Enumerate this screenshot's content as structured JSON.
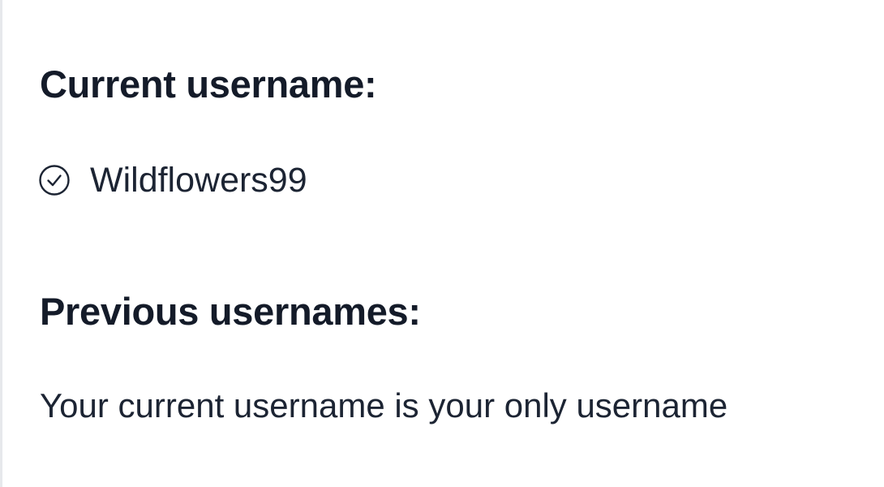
{
  "current": {
    "heading": "Current username:",
    "username": "Wildflowers99",
    "icon": "check-circle-icon"
  },
  "previous": {
    "heading": "Previous usernames:",
    "empty_message": "Your current username is your only username"
  },
  "colors": {
    "text": "#1c2433",
    "heading": "#141b29",
    "background": "#ffffff",
    "left_border": "#e6e8ec"
  }
}
